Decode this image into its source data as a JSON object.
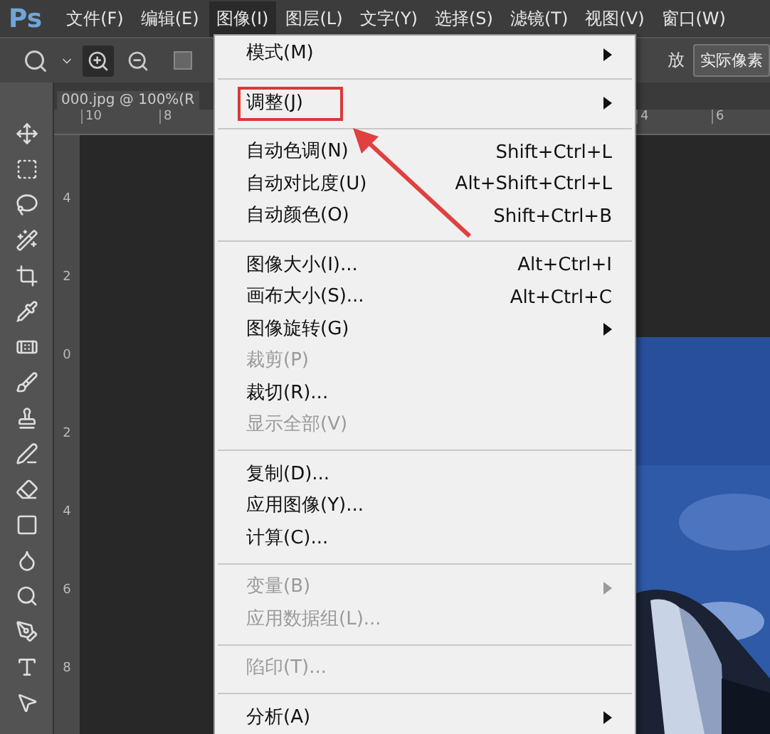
{
  "menubar": {
    "logo": "Ps",
    "items": [
      {
        "label": "文件(F)",
        "selected": false
      },
      {
        "label": "编辑(E)",
        "selected": false
      },
      {
        "label": "图像(I)",
        "selected": true
      },
      {
        "label": "图层(L)",
        "selected": false
      },
      {
        "label": "文字(Y)",
        "selected": false
      },
      {
        "label": "选择(S)",
        "selected": false
      },
      {
        "label": "滤镜(T)",
        "selected": false
      },
      {
        "label": "视图(V)",
        "selected": false
      },
      {
        "label": "窗口(W)",
        "selected": false
      }
    ]
  },
  "options_bar": {
    "zoom_in_selected": true,
    "checked": false,
    "partial_label": "放",
    "button": "实际像素"
  },
  "document_tab": {
    "title": "000.jpg @ 100%(R"
  },
  "top_ruler": [
    "10",
    "8",
    "4",
    "6"
  ],
  "left_ruler": [
    "4",
    "2",
    "0",
    "2",
    "4",
    "6",
    "8"
  ],
  "menu": [
    {
      "kind": "item",
      "label": "模式(M)",
      "submenu": true,
      "disabled": false,
      "boxed": false
    },
    {
      "kind": "separator"
    },
    {
      "kind": "item",
      "label": "调整(J)",
      "submenu": true,
      "disabled": false,
      "boxed": true
    },
    {
      "kind": "separator"
    },
    {
      "kind": "item",
      "label": "自动色调(N)",
      "shortcut": "Shift+Ctrl+L",
      "submenu": false,
      "disabled": false,
      "boxed": false
    },
    {
      "kind": "item",
      "label": "自动对比度(U)",
      "shortcut": "Alt+Shift+Ctrl+L",
      "submenu": false,
      "disabled": false,
      "boxed": false
    },
    {
      "kind": "item",
      "label": "自动颜色(O)",
      "shortcut": "Shift+Ctrl+B",
      "submenu": false,
      "disabled": false,
      "boxed": false
    },
    {
      "kind": "separator"
    },
    {
      "kind": "item",
      "label": "图像大小(I)...",
      "shortcut": "Alt+Ctrl+I",
      "submenu": false,
      "disabled": false,
      "boxed": false
    },
    {
      "kind": "item",
      "label": "画布大小(S)...",
      "shortcut": "Alt+Ctrl+C",
      "submenu": false,
      "disabled": false,
      "boxed": false
    },
    {
      "kind": "item",
      "label": "图像旋转(G)",
      "submenu": true,
      "disabled": false,
      "boxed": false
    },
    {
      "kind": "item",
      "label": "裁剪(P)",
      "submenu": false,
      "disabled": true,
      "boxed": false
    },
    {
      "kind": "item",
      "label": "裁切(R)...",
      "submenu": false,
      "disabled": false,
      "boxed": false
    },
    {
      "kind": "item",
      "label": "显示全部(V)",
      "submenu": false,
      "disabled": true,
      "boxed": false
    },
    {
      "kind": "separator"
    },
    {
      "kind": "item",
      "label": "复制(D)...",
      "submenu": false,
      "disabled": false,
      "boxed": false
    },
    {
      "kind": "item",
      "label": "应用图像(Y)...",
      "submenu": false,
      "disabled": false,
      "boxed": false
    },
    {
      "kind": "item",
      "label": "计算(C)...",
      "submenu": false,
      "disabled": false,
      "boxed": false
    },
    {
      "kind": "separator"
    },
    {
      "kind": "item",
      "label": "变量(B)",
      "submenu": true,
      "disabled": true,
      "boxed": false
    },
    {
      "kind": "item",
      "label": "应用数据组(L)...",
      "submenu": false,
      "disabled": true,
      "boxed": false
    },
    {
      "kind": "separator"
    },
    {
      "kind": "item",
      "label": "陷印(T)...",
      "submenu": false,
      "disabled": true,
      "boxed": false
    },
    {
      "kind": "separator"
    },
    {
      "kind": "item",
      "label": "分析(A)",
      "submenu": true,
      "disabled": false,
      "boxed": false
    }
  ]
}
